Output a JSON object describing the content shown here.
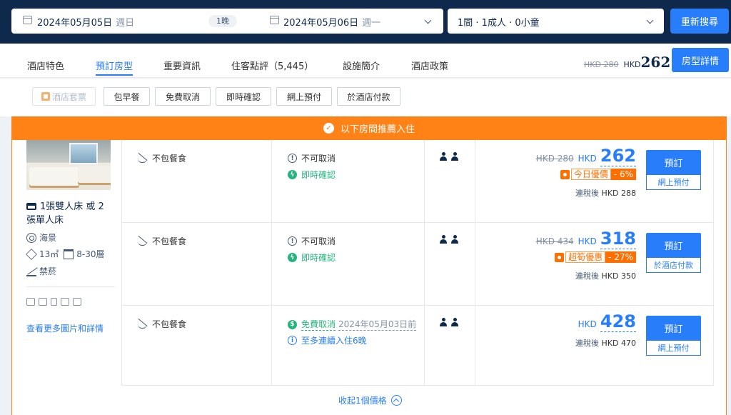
{
  "search": {
    "checkin_date": "2024年05月05日",
    "checkin_weekday": "週日",
    "nights": "1晚",
    "checkout_date": "2024年05月06日",
    "checkout_weekday": "週一",
    "guests": "1間 · 1成人 · 0小童",
    "search_button": "重新搜尋"
  },
  "tabs": [
    "酒店特色",
    "預訂房型",
    "重要資訊",
    "住客點評（5,445）",
    "設施簡介",
    "酒店政策"
  ],
  "active_tab": "預訂房型",
  "header_price": {
    "old": "HKD 280",
    "currency": "HKD",
    "value": "262",
    "button": "房型詳情"
  },
  "filters": [
    "酒店套票",
    "包早餐",
    "免費取消",
    "即時確認",
    "網上預付",
    "於酒店付款"
  ],
  "banner": "以下房間推薦入住",
  "room": {
    "bed": "1張雙人床 或 2張單人床",
    "view": "海景",
    "size": "13㎡",
    "floor": "8-30層",
    "smoking": "禁菸",
    "more_link": "查看更多圖片和詳情",
    "amenity_icons": [
      "tv-icon",
      "kettle-icon",
      "fridge-icon",
      "shower-icon",
      "phone-icon"
    ]
  },
  "rates": [
    {
      "meal": "不包餐食",
      "policy": "不可取消",
      "confirm": "即時確認",
      "old_price": "HKD 280",
      "currency": "HKD",
      "price": "262",
      "deal_label": "今日優價",
      "deal_pct": "- 6%",
      "tax_label": "連稅後",
      "tax_price": "HKD 288",
      "book": "預訂",
      "pay": "網上預付"
    },
    {
      "meal": "不包餐食",
      "policy": "不可取消",
      "confirm": "即時確認",
      "old_price": "HKD 434",
      "currency": "HKD",
      "price": "318",
      "deal_label": "超筍優惠",
      "deal_pct": "- 27%",
      "tax_label": "連稅後",
      "tax_price": "HKD 350",
      "book": "預訂",
      "pay": "於酒店付款"
    },
    {
      "meal": "不包餐食",
      "policy_free": "免費取消",
      "policy_date": "2024年05月03日前",
      "max_stay": "至多連續入住6晚",
      "currency": "HKD",
      "price": "428",
      "tax_label": "連稅後",
      "tax_price": "HKD 470",
      "book": "預訂",
      "pay": "網上預付"
    }
  ],
  "collapse": "收起1個價格",
  "colors": {
    "navy": "#0f294d",
    "blue": "#287dfa",
    "orange": "#ff8216",
    "green": "#24b47e"
  }
}
